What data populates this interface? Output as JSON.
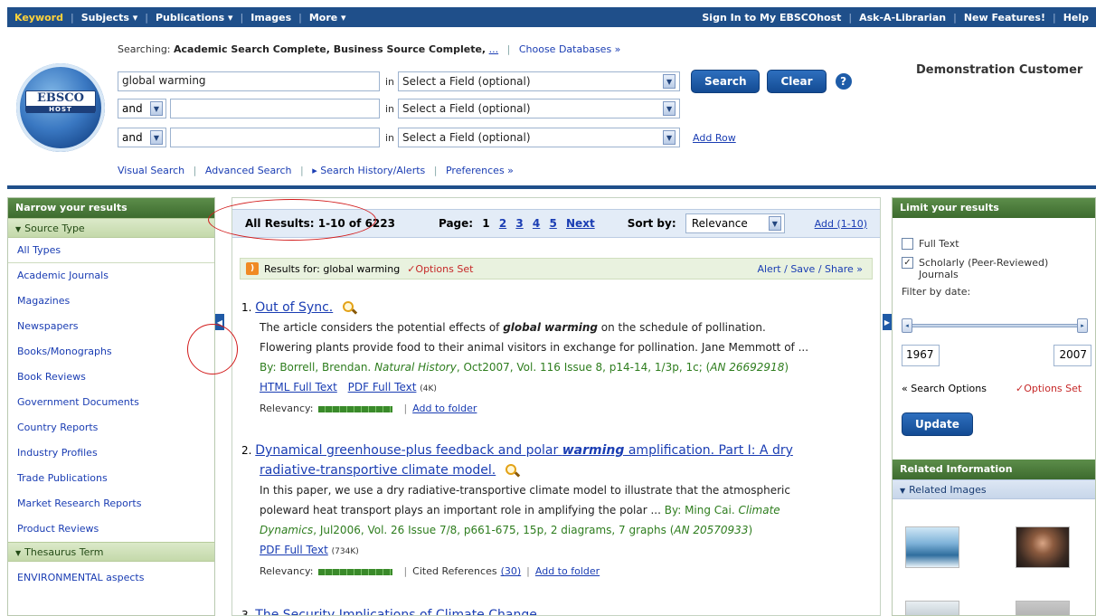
{
  "topnav": {
    "left": [
      "Keyword",
      "Subjects ▾",
      "Publications ▾",
      "Images",
      "More ▾"
    ],
    "right": [
      "Sign In to My EBSCOhost",
      "Ask-A-Librarian",
      "New Features!",
      "Help"
    ]
  },
  "logo": {
    "name": "EBSCO",
    "sub": "HOST"
  },
  "searching": {
    "prefix": "Searching:",
    "dbs": "Academic Search Complete, Business Source Complete,",
    "more": "...",
    "choose": "Choose Databases »"
  },
  "search": {
    "row1_value": "global warming",
    "in": "in",
    "field_placeholder": "Select a Field (optional)",
    "bool": "and",
    "search_btn": "Search",
    "clear_btn": "Clear",
    "help": "?",
    "add_row": "Add Row"
  },
  "customer": "Demonstration Customer",
  "subnav": [
    "Visual Search",
    "Advanced Search",
    "▸ Search History/Alerts",
    "Preferences »"
  ],
  "left": {
    "title": "Narrow your results",
    "source_type_header": "Source Type",
    "source_types": [
      "All Types",
      "Academic Journals",
      "Magazines",
      "Newspapers",
      "Books/Monographs",
      "Book Reviews",
      "Government Documents",
      "Country Reports",
      "Industry Profiles",
      "Trade Publications",
      "Market Research Reports",
      "Product Reviews"
    ],
    "thesaurus_header": "Thesaurus Term",
    "thesaurus_terms": [
      "ENVIRONMENTAL aspects"
    ]
  },
  "results_header": {
    "all_results": "All Results: 1-10 of 6223",
    "page_label": "Page:",
    "pages": [
      "1",
      "2",
      "3",
      "4",
      "5",
      "Next"
    ],
    "sort_label": "Sort by:",
    "sort_value": "Relevance",
    "add": "Add (1-10)"
  },
  "results_for": {
    "text": "Results for: global warming",
    "options": "✓Options Set",
    "alert": "Alert / Save / Share »"
  },
  "results": [
    {
      "num": "1.",
      "title": "Out of Sync.",
      "desc_pre": "The article considers the potential effects of ",
      "desc_hl": "global warming",
      "desc_post": " on the schedule of pollination.",
      "desc2": "Flowering plants provide food to their animal visitors in exchange for pollination. Jane Memmott of ...",
      "by_pre": "By: Borrell, Brendan. ",
      "by_journal": "Natural History",
      "by_post": ", Oct2007, Vol. 116 Issue 8, p14-14, 1/3p, 1c; (",
      "by_an": "AN 26692918",
      "by_end": ")",
      "html_link": "HTML Full Text",
      "pdf_link": "PDF Full Text",
      "pdf_size": "(4K)",
      "relevancy": "Relevancy:",
      "add_folder": "Add to folder"
    },
    {
      "num": "2.",
      "title_pre": "Dynamical greenhouse-plus feedback and polar ",
      "title_hl": "warming",
      "title_post": " amplification. Part I: A dry",
      "title_line2": "radiative-transportive climate model.",
      "desc": "In this paper, we use a dry radiative-transportive climate model to illustrate that the atmospheric",
      "desc2_pre": "poleward heat transport plays an important role in amplifying the polar ... ",
      "by2_pre": "By: Ming Cai. ",
      "by2_journal": "Climate",
      "by3_journal": "Dynamics",
      "by3_post": ", Jul2006, Vol. 26 Issue 7/8, p661-675, 15p, 2 diagrams, 7 graphs (",
      "by3_an": "AN 20570933",
      "by3_end": ")",
      "pdf_link": "PDF Full Text",
      "pdf_size": "(734K)",
      "relevancy": "Relevancy:",
      "cited": "Cited References",
      "cited_count": "(30)",
      "add_folder": "Add to folder"
    },
    {
      "num": "3.",
      "title": "The Security Implications of Climate Change."
    }
  ],
  "right": {
    "title": "Limit your results",
    "full_text": "Full Text",
    "scholarly": "Scholarly (Peer-Reviewed)",
    "scholarly2": "Journals",
    "filter_date": "Filter by date:",
    "date_from": "1967",
    "date_to": "2007",
    "search_options": "« Search Options",
    "options_set": "✓Options Set",
    "update": "Update",
    "related_info": "Related Information",
    "related_images": "Related Images"
  },
  "colors": {
    "nav_bg": "#1f4f8a",
    "link": "#1a3db3",
    "green_header": "#3d6b2e",
    "annotation": "#d21c1c"
  }
}
